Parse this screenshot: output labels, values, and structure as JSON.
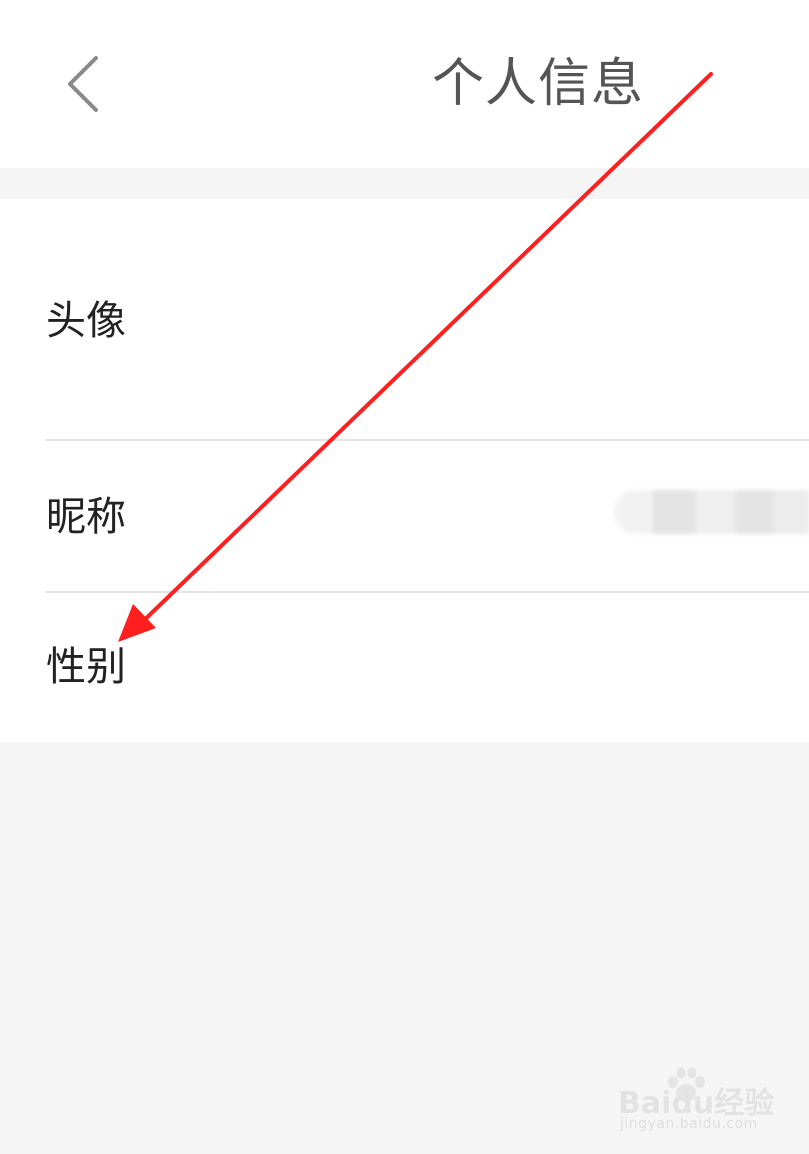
{
  "header": {
    "title": "个人信息",
    "back_icon": "chevron-left-icon"
  },
  "profile_rows": [
    {
      "label": "头像"
    },
    {
      "label": "昵称"
    },
    {
      "label": "性别"
    }
  ],
  "annotation": {
    "color": "#ff1f1f"
  },
  "watermark": {
    "brand": "Baidu经验",
    "url": "jingyan.baidu.com"
  }
}
